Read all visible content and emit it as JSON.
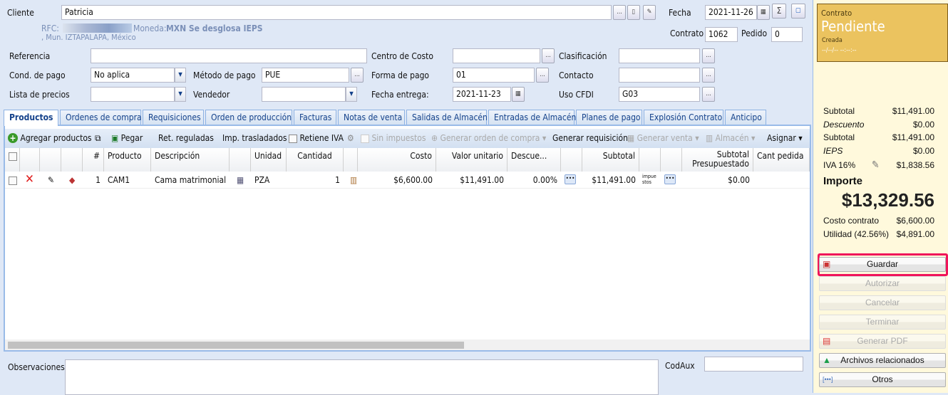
{
  "header": {
    "cliente_label": "Cliente",
    "cliente_value": "Patricia",
    "rfc_label": "RFC:",
    "moneda_label": "Moneda:",
    "moneda_value": "MXN Se desglosa IEPS",
    "address": ", Mun. IZTAPALAPA, México",
    "fecha_label": "Fecha",
    "fecha_value": "2021-11-26",
    "contrato_label": "Contrato",
    "contrato_value": "1062",
    "pedido_label": "Pedido",
    "pedido_value": "0",
    "ellipsis": "...",
    "sigma": "Σ"
  },
  "form": {
    "referencia": "Referencia",
    "centro_costo": "Centro de Costo",
    "clasificacion": "Clasificación",
    "cond_pago": "Cond. de pago",
    "cond_pago_value": "No aplica",
    "metodo_pago": "Método de pago",
    "metodo_pago_value": "PUE",
    "forma_pago": "Forma de pago",
    "forma_pago_value": "01",
    "contacto": "Contacto",
    "lista_precios": "Lista de precios",
    "vendedor": "Vendedor",
    "fecha_entrega": "Fecha entrega:",
    "fecha_entrega_value": "2021-11-23",
    "uso_cfdi": "Uso CFDI",
    "uso_cfdi_value": "G03"
  },
  "tabs": [
    "Productos",
    "Ordenes de compra",
    "Requisiciones",
    "Orden de producción",
    "Facturas",
    "Notas de venta",
    "Salidas de Almacén",
    "Entradas de Almacén",
    "Planes de pago",
    "Explosión Contrato",
    "Anticipo"
  ],
  "toolbar": {
    "agregar": "Agregar productos",
    "pegar": "Pegar",
    "ret": "Ret. reguladas",
    "imp": "Imp. trasladados",
    "retiene": "Retiene IVA",
    "sin": "Sin impuestos",
    "gen_oc": "Generar orden de compra",
    "gen_req": "Generar requisición",
    "gen_venta": "Generar venta",
    "almacen": "Almacén",
    "asignar": "Asignar"
  },
  "grid": {
    "headers": {
      "num": "#",
      "producto": "Producto",
      "descripcion": "Descripción",
      "unidad": "Unidad",
      "cantidad": "Cantidad",
      "costo": "Costo",
      "valor": "Valor unitario",
      "descuento": "Descue...",
      "subtotal": "Subtotal",
      "subtotal_pres": "Subtotal Presupuestado",
      "cant_pedida": "Cant pedida"
    },
    "rows": [
      {
        "num": "1",
        "producto": "CAM1",
        "descripcion": "Cama matrimonial",
        "unidad": "PZA",
        "cantidad": "1",
        "costo": "$6,600.00",
        "valor": "$11,491.00",
        "descuento": "0.00%",
        "subtotal": "$11,491.00",
        "impuestos": "impuestos",
        "subtotal_pres": "$0.00"
      }
    ]
  },
  "bottom": {
    "observaciones": "Observaciones",
    "codaux": "CodAux"
  },
  "status": {
    "title": "Contrato",
    "state": "Pendiente",
    "sub": "Creada",
    "date": "--/--/-- --:--:--"
  },
  "totals": {
    "subtotal_label": "Subtotal",
    "subtotal": "$11,491.00",
    "descuento_label": "Descuento",
    "descuento": "$0.00",
    "subtotal2_label": "Subtotal",
    "subtotal2": "$11,491.00",
    "ieps_label": "IEPS",
    "ieps": "$0.00",
    "iva_label": "IVA 16%",
    "iva": "$1,838.56",
    "importe_label": "Importe",
    "importe": "$13,329.56",
    "costo_label": "Costo contrato",
    "costo": "$6,600.00",
    "utilidad_label": "Utilidad (42.56%)",
    "utilidad": "$4,891.00"
  },
  "actions": [
    "Guardar",
    "Autorizar",
    "Cancelar",
    "Terminar",
    "Generar PDF",
    "Archivos relacionados",
    "Otros"
  ],
  "colors": {
    "status": "#ebc35f",
    "highlight": "#f0145a",
    "panel": "#dfe8f6"
  }
}
